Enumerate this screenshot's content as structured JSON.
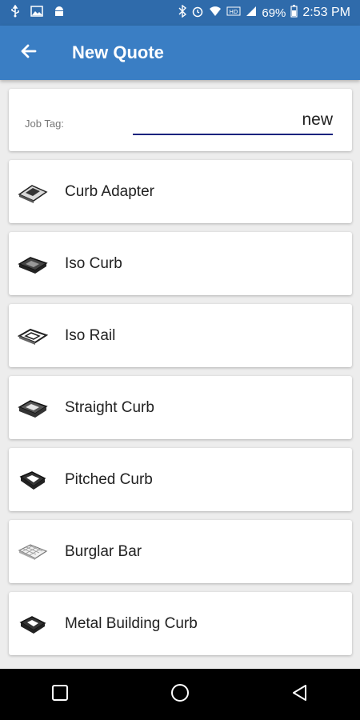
{
  "status_bar": {
    "left_icons": [
      "usb-icon",
      "image-icon",
      "android-icon"
    ],
    "right_icons": [
      "bluetooth-icon",
      "alarm-icon",
      "wifi-icon",
      "volte-icon",
      "signal-icon"
    ],
    "battery": "69%",
    "time": "2:53 PM"
  },
  "app_bar": {
    "back_icon": "arrow-back-icon",
    "title": "New Quote"
  },
  "job_tag": {
    "label": "Job Tag:",
    "value": "new"
  },
  "products": [
    {
      "label": "Curb Adapter",
      "icon": "curb-adapter-icon"
    },
    {
      "label": "Iso Curb",
      "icon": "iso-curb-icon"
    },
    {
      "label": "Iso Rail",
      "icon": "iso-rail-icon"
    },
    {
      "label": "Straight Curb",
      "icon": "straight-curb-icon"
    },
    {
      "label": "Pitched Curb",
      "icon": "pitched-curb-icon"
    },
    {
      "label": "Burglar Bar",
      "icon": "burglar-bar-icon"
    },
    {
      "label": "Metal Building Curb",
      "icon": "metal-building-curb-icon"
    }
  ],
  "nav_bar": {
    "buttons": [
      "recents-button",
      "home-button",
      "back-button"
    ]
  },
  "colors": {
    "status_bar": "#2f6bab",
    "app_bar": "#3a7ec4",
    "background": "#ededed",
    "input_underline": "#1a237e"
  }
}
